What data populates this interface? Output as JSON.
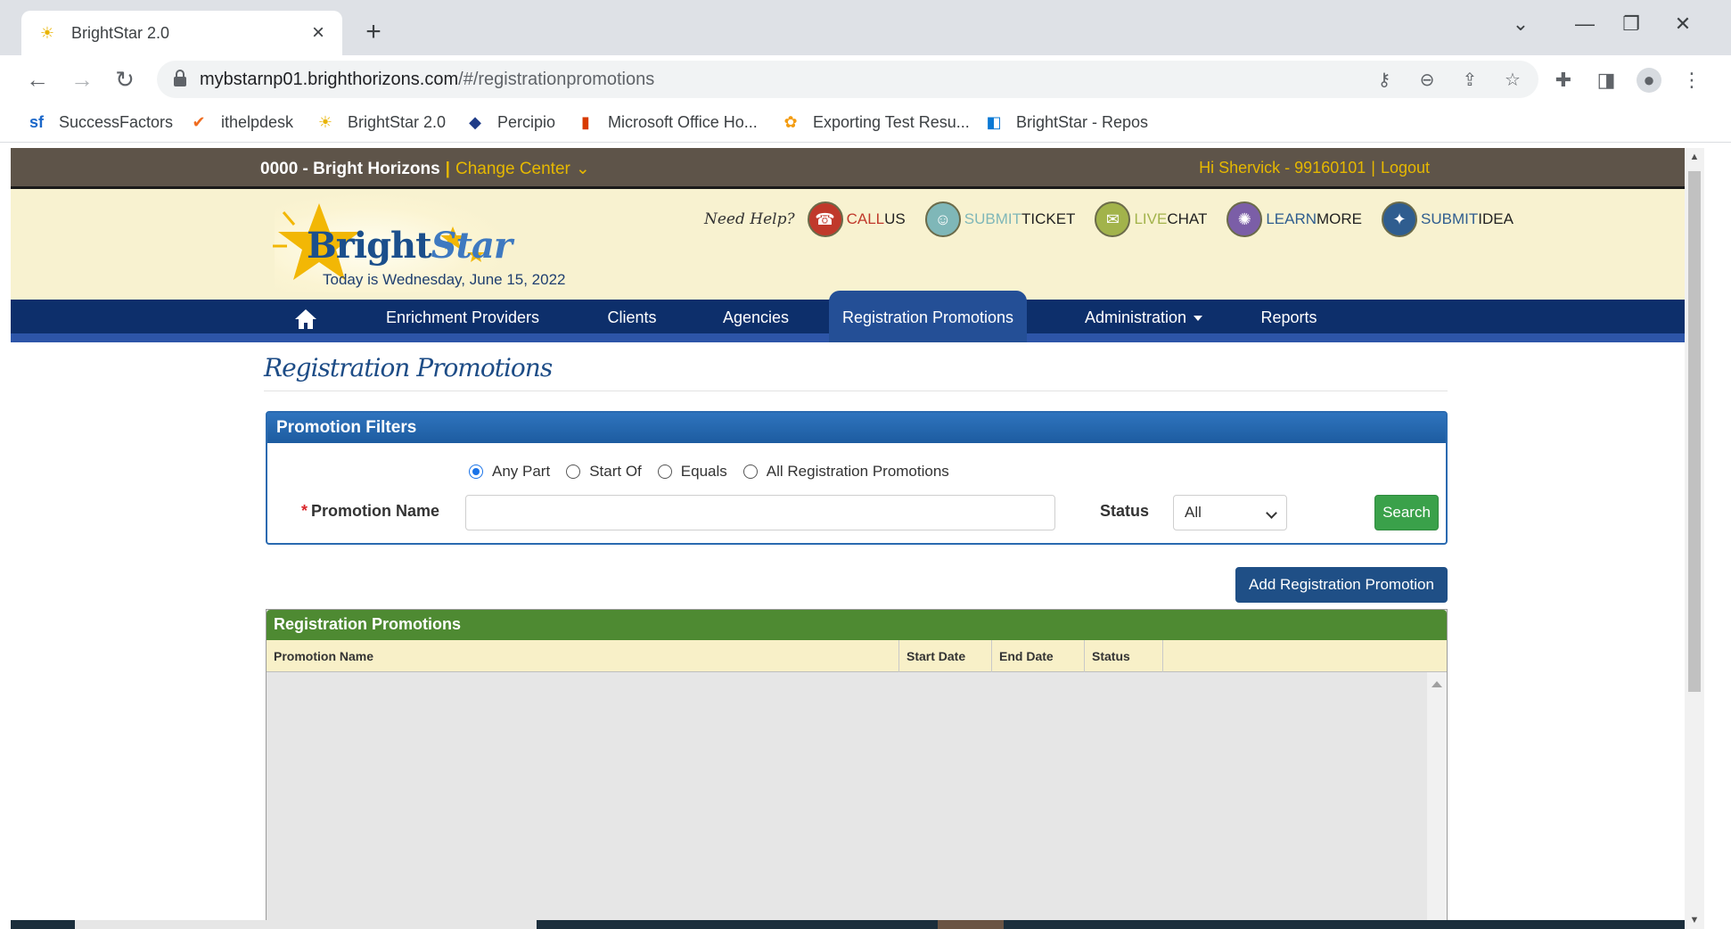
{
  "browser": {
    "tab_title": "BrightStar 2.0",
    "tab_close": "×",
    "new_tab": "+",
    "url_host": "mybstarnp01.brighthorizons.com",
    "url_path": "/#/registrationpromotions",
    "bookmarks": [
      {
        "label": "SuccessFactors",
        "icon": "sf",
        "color": "#1b67c9"
      },
      {
        "label": "ithelpdesk",
        "icon": "✔",
        "color": "#ef6c20"
      },
      {
        "label": "BrightStar 2.0",
        "icon": "☀",
        "color": "#e8b300"
      },
      {
        "label": "Percipio",
        "icon": "◆",
        "color": "#1f3c88"
      },
      {
        "label": "Microsoft Office Ho...",
        "icon": "▮",
        "color": "#d83b01"
      },
      {
        "label": "Exporting Test Resu...",
        "icon": "✿",
        "color": "#f39c12"
      },
      {
        "label": "BrightStar - Repos",
        "icon": "◧",
        "color": "#0a78d4"
      }
    ]
  },
  "topbar": {
    "center": "0000 - Bright Horizons",
    "separator": "|",
    "change_center": "Change Center",
    "greeting": "Hi Shervick - 99160101",
    "logout": "Logout"
  },
  "banner": {
    "brand_a": "Bright",
    "brand_b": "Star",
    "date_text": "Today is Wednesday, June 15, 2022",
    "need_help": "Need Help?",
    "help_items": [
      {
        "a": "CALL",
        "b": " US",
        "icon": "phone-icon",
        "bg": "#c0392b",
        "glyph": "☎"
      },
      {
        "a": "SUBMIT",
        "b": " TICKET",
        "icon": "person-icon",
        "bg": "#7fb7b8",
        "glyph": "☺"
      },
      {
        "a": "LIVE",
        "b": " CHAT",
        "icon": "chat-icon",
        "bg": "#a2b34b",
        "glyph": "✉"
      },
      {
        "a": "LEARN",
        "b": " MORE",
        "icon": "learn-icon",
        "bg": "#7b5ea7",
        "glyph": "✺"
      },
      {
        "a": "SUBMIT",
        "b": " IDEA",
        "icon": "lightbulb-icon",
        "bg": "#2f5d8f",
        "glyph": "✦"
      }
    ]
  },
  "nav": {
    "items": [
      "Enrichment Providers",
      "Clients",
      "Agencies",
      "Registration Promotions",
      "Administration",
      "Reports"
    ],
    "active": "Registration Promotions"
  },
  "page": {
    "title": "Registration Promotions"
  },
  "filters": {
    "header": "Promotion Filters",
    "radios": [
      {
        "label": "Any Part",
        "checked": true
      },
      {
        "label": "Start Of",
        "checked": false
      },
      {
        "label": "Equals",
        "checked": false
      },
      {
        "label": "All Registration Promotions",
        "checked": false
      }
    ],
    "required_mark": "*",
    "promotion_label": "Promotion Name",
    "promotion_value": "",
    "status_label": "Status",
    "status_value": "All",
    "search_label": "Search"
  },
  "actions": {
    "add_label": "Add Registration Promotion"
  },
  "grid": {
    "header": "Registration Promotions",
    "columns": [
      "Promotion Name",
      "Start Date",
      "End Date",
      "Status"
    ],
    "rows": []
  },
  "colors": {
    "topbar": "#5e5449",
    "nav": "#0d2f6b",
    "accent_gold": "#e6b800",
    "grid_header": "#4e8a32",
    "search_button": "#3aa14a",
    "add_button": "#1f4f86"
  }
}
